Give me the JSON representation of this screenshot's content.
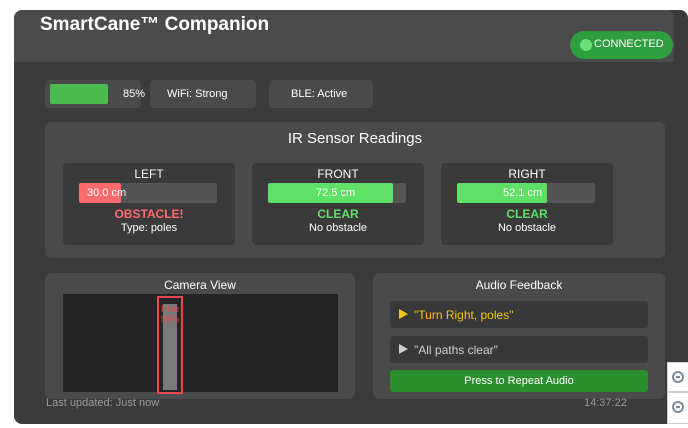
{
  "app": {
    "title": "SmartCane™ Companion",
    "connection": {
      "label": "CONNECTED",
      "color": "#2e9e3f"
    }
  },
  "status": {
    "battery": {
      "label": "85%",
      "level": 0.85
    },
    "wifi": "WiFi: Strong",
    "ble": "BLE: Active"
  },
  "sensors": {
    "title": "IR Sensor Readings",
    "left": {
      "name": "LEFT",
      "distance": "30.0 cm",
      "fill_fraction": 0.3,
      "state": "OBSTACLE!",
      "detail": "Type: poles",
      "color": "#ff6b6b"
    },
    "front": {
      "name": "FRONT",
      "distance": "72.5 cm",
      "fill_fraction": 0.92,
      "state": "CLEAR",
      "detail": "No obstacle",
      "color": "#5fe066"
    },
    "right": {
      "name": "RIGHT",
      "distance": "52.1 cm",
      "fill_fraction": 0.65,
      "state": "CLEAR",
      "detail": "No obstacle",
      "color": "#5fe066"
    }
  },
  "camera": {
    "title": "Camera View",
    "detection_label": "Pole",
    "detection_conf": "98%"
  },
  "audio": {
    "title": "Audio Feedback",
    "messages": [
      {
        "text": "\"Turn Right, poles\"",
        "color": "#f5c518",
        "active": true
      },
      {
        "text": "\"All paths clear\"",
        "color": "#cfcfcf",
        "active": false
      }
    ],
    "repeat_label": "Press to Repeat Audio"
  },
  "footer": {
    "updated": "Last updated: Just now",
    "time": "14:37:22"
  },
  "colors": {
    "accent_green": "#2a8f2e",
    "danger": "#ff6b6b",
    "warning": "#f5c518"
  },
  "icons": {
    "zoom_in": "zoom-in-icon",
    "zoom_out": "zoom-out-icon"
  }
}
